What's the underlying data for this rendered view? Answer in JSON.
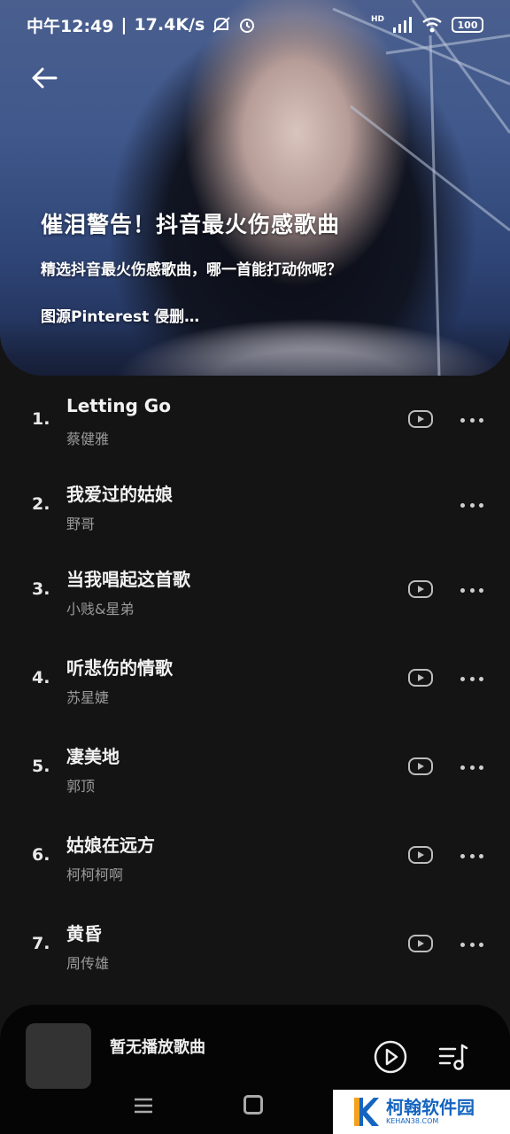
{
  "status_bar": {
    "time": "中午12:49",
    "separator": "|",
    "speed": "17.4K/s",
    "network_label": "HD",
    "battery": "100"
  },
  "playlist": {
    "title": "催泪警告！抖音最火伤感歌曲",
    "description": "精选抖音最火伤感歌曲，哪一首能打动你呢？",
    "credit": "图源Pinterest 侵删…"
  },
  "songs": [
    {
      "num": "1.",
      "title": "Letting Go",
      "artist": "蔡健雅",
      "has_mv": true
    },
    {
      "num": "2.",
      "title": "我爱过的姑娘",
      "artist": "野哥",
      "has_mv": false
    },
    {
      "num": "3.",
      "title": "当我唱起这首歌",
      "artist": "小贱&星弟",
      "has_mv": true
    },
    {
      "num": "4.",
      "title": "听悲伤的情歌",
      "artist": "苏星婕",
      "has_mv": true
    },
    {
      "num": "5.",
      "title": "凄美地",
      "artist": "郭顶",
      "has_mv": true
    },
    {
      "num": "6.",
      "title": "姑娘在远方",
      "artist": "柯柯柯啊",
      "has_mv": true
    },
    {
      "num": "7.",
      "title": "黄昏",
      "artist": "周传雄",
      "has_mv": true
    }
  ],
  "player": {
    "now_playing": "暂无播放歌曲"
  },
  "watermark": {
    "name": "柯翰软件园",
    "domain": "KEHAN38.COM"
  },
  "colors": {
    "background": "#141414",
    "player_bar": "#050505",
    "artist_text": "#9a9a9a",
    "watermark_blue": "#1565c0"
  }
}
